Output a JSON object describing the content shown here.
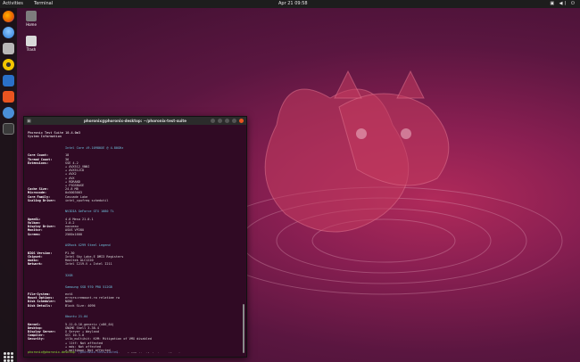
{
  "topbar": {
    "activities": "Activities",
    "app": "Terminal",
    "clock": "Apr 21 09:58",
    "tray": "▣ ◀) ⏻"
  },
  "dock": {
    "items": [
      {
        "name": "firefox",
        "color": "#e66000"
      },
      {
        "name": "thunderbird",
        "color": "#2a7ad5"
      },
      {
        "name": "files",
        "color": "#b8b8b8"
      },
      {
        "name": "rhythmbox",
        "color": "#f2c500"
      },
      {
        "name": "libreoffice-writer",
        "color": "#2a70c9"
      },
      {
        "name": "ubuntu-software",
        "color": "#e95420"
      },
      {
        "name": "help",
        "color": "#4a8fd8"
      },
      {
        "name": "terminal",
        "color": "#3a3a3a"
      }
    ]
  },
  "desktop": {
    "home_label": "Home",
    "trash_label": "Trash"
  },
  "terminal": {
    "title": "phoronix@phoronix-desktop: ~/phoronix-test-suite",
    "header": "Phoronix Test Suite 10.4.0m3\nSystem Information",
    "processor_heading": "Intel Core i9-10980XE @ 4.80GHz",
    "rows_cpu": [
      {
        "k": "Core Count:",
        "v": "18"
      },
      {
        "k": "Thread Count:",
        "v": "36"
      },
      {
        "k": "Extensions:",
        "v": "SSE 4.2\n+ AVX512_VNNI\n+ AVX512CD\n+ AVX2\n+ AVX\n+ RDRAND\n+ FSGSBASE"
      },
      {
        "k": "Cache Size:",
        "v": "24.8 MB"
      },
      {
        "k": "Microcode:",
        "v": "0x5003003"
      },
      {
        "k": "Core Family:",
        "v": "Cascade Lake"
      },
      {
        "k": "Scaling Driver:",
        "v": "intel_cpufreq schedutil"
      }
    ],
    "graphics_heading": "NVIDIA GeForce GTX 1080 Ti",
    "rows_gpu": [
      {
        "k": "OpenGL:",
        "v": "4.6 Mesa 21.0.1"
      },
      {
        "k": "Vulkan:",
        "v": "1.0.2"
      },
      {
        "k": "Display Driver:",
        "v": "nouveau"
      },
      {
        "k": "Monitor:",
        "v": "ASUS VP28U"
      },
      {
        "k": "Screen:",
        "v": "2560x1600"
      }
    ],
    "motherboard_heading": "ASRock X299 Steel Legend",
    "rows_mb": [
      {
        "k": "BIOS Version:",
        "v": "P1.30"
      },
      {
        "k": "Chipset:",
        "v": "Intel Sky Lake-E DMI3 Registers"
      },
      {
        "k": "Audio:",
        "v": "Realtek ALC1220"
      },
      {
        "k": "Network:",
        "v": "Intel I219-V + Intel I211"
      }
    ],
    "memory_heading": "32GB",
    "disk_heading": "Samsung SSD 970 PRO 512GB",
    "rows_disk": [
      {
        "k": "File-System:",
        "v": "ext4"
      },
      {
        "k": "Mount Options:",
        "v": "errors=remount-ro relatime rw"
      },
      {
        "k": "Disk Scheduler:",
        "v": "NONE"
      },
      {
        "k": "Disk Details:",
        "v": "Block Size: 4096"
      }
    ],
    "os_heading": "Ubuntu 21.04",
    "rows_os": [
      {
        "k": "Kernel:",
        "v": "5.11.0-16-generic (x86_64)"
      },
      {
        "k": "Desktop:",
        "v": "GNOME Shell 3.38.4"
      },
      {
        "k": "Display Server:",
        "v": "X Server + Wayland"
      },
      {
        "k": "Compiler:",
        "v": "GCC 10.3.0"
      },
      {
        "k": "Security:",
        "v": "itlb_multihit: KVM: Mitigation of VMX disabled\n+ l1tf: Not affected\n+ mds: Not affected\n+ meltdown: Not affected\n+ spec_store_bypass: Mitigation of SSB disabled via prctl and seccomp\n+ spectre_v1: Mitigation of usercopy/swapgs barriers and __user pointer sanitization\n+ spectre_v2: Mitigation of Enhanced IBRS IBPB: conditional RSB filling\n+ srbds: Not affected\n+ tsx_async_abort: Mitigation of TSX disabled"
      }
    ],
    "prompt_user": "phoronix@phoronix-desktop",
    "prompt_path": ":~/phoronix-test-suite$"
  }
}
